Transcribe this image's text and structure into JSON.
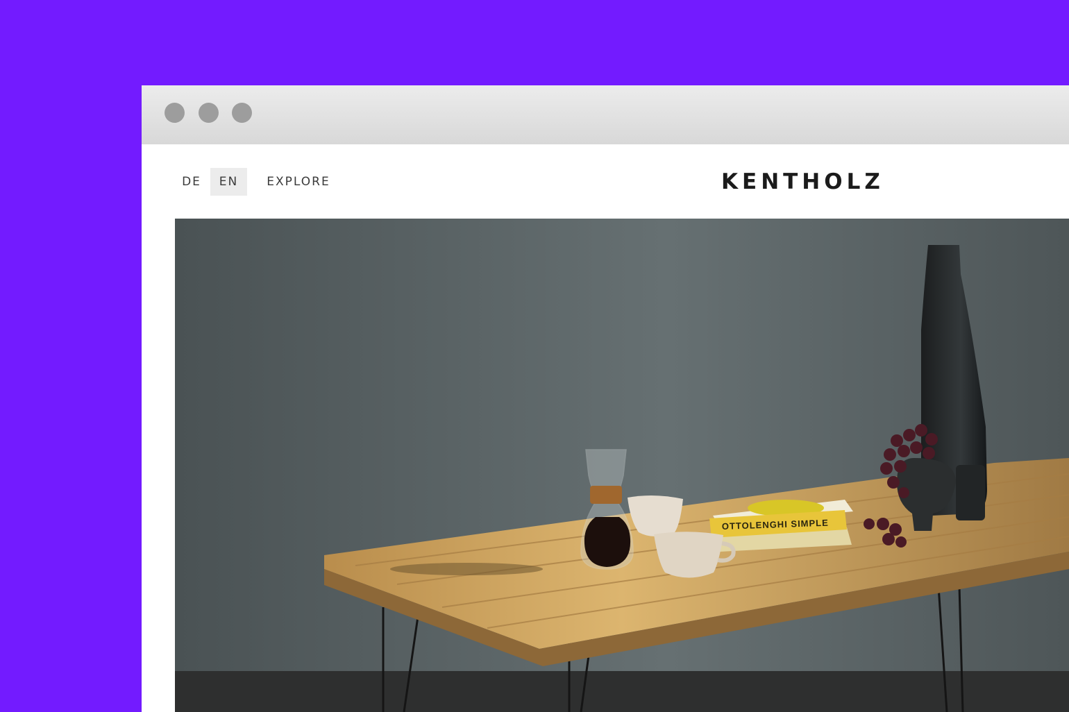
{
  "window": {
    "controls": [
      "close",
      "minimize",
      "maximize"
    ]
  },
  "nav": {
    "languages": [
      {
        "label": "DE",
        "active": false
      },
      {
        "label": "EN",
        "active": true
      }
    ],
    "explore_label": "EXPLORE"
  },
  "brand": {
    "logo_text": "KENTHOLZ"
  },
  "hero": {
    "book_title": "OTTOLENGHI SIMPLE",
    "colors": {
      "wall": "#5b6466",
      "floor": "#2e2f2f",
      "table": "#c59a55",
      "vase": "#26292a"
    }
  },
  "colors": {
    "background": "#731bff",
    "titlebar": "#e1e1e1",
    "dot": "#9d9d9d"
  }
}
